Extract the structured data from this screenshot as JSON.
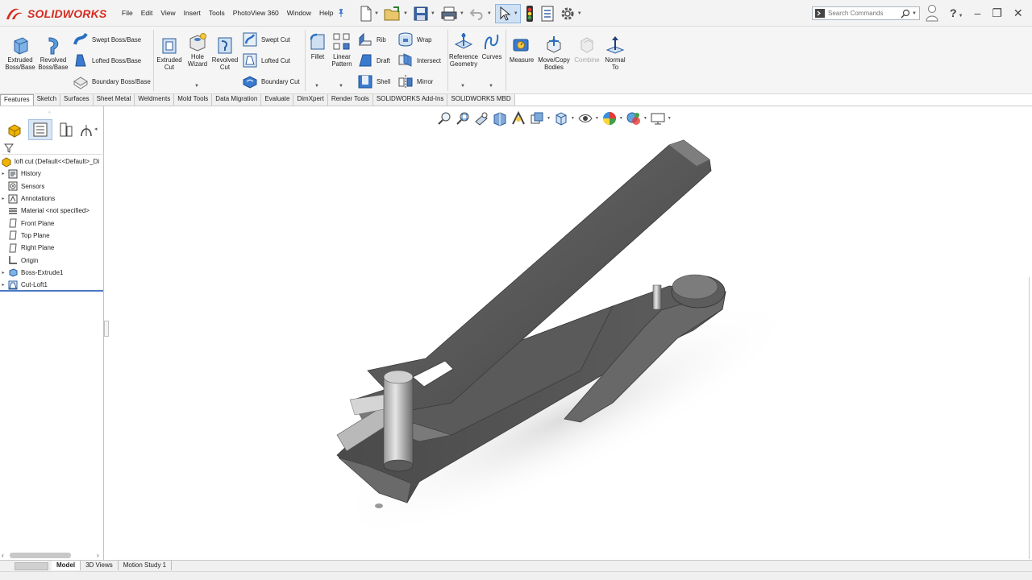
{
  "app": {
    "brand": "SOLIDWORKS",
    "menu": [
      "File",
      "Edit",
      "View",
      "Insert",
      "Tools",
      "PhotoView 360",
      "Window",
      "Help"
    ],
    "search": {
      "placeholder": "Search Commands"
    },
    "colors": {
      "brand": "#d52b1e",
      "accent": "#2a6fc2",
      "selected_tab": "#ffffff"
    }
  },
  "ribbon": {
    "extruded_boss": "Extruded\nBoss/Base",
    "revolved_boss": "Revolved\nBoss/Base",
    "swept_boss": "Swept Boss/Base",
    "lofted_boss": "Lofted Boss/Base",
    "boundary_boss": "Boundary Boss/Base",
    "extruded_cut": "Extruded\nCut",
    "hole_wizard": "Hole\nWizard",
    "revolved_cut": "Revolved\nCut",
    "swept_cut": "Swept Cut",
    "lofted_cut": "Lofted Cut",
    "boundary_cut": "Boundary Cut",
    "fillet": "Fillet",
    "linear_pattern": "Linear\nPattern",
    "rib": "Rib",
    "draft": "Draft",
    "shell": "Shell",
    "wrap": "Wrap",
    "intersect": "Intersect",
    "mirror": "Mirror",
    "reference_geometry": "Reference\nGeometry",
    "curves": "Curves",
    "measure": "Measure",
    "move_copy_bodies": "Move/Copy\nBodies",
    "combine": "Combine",
    "normal_to": "Normal\nTo"
  },
  "cm_tabs": [
    {
      "label": "Features",
      "active": true
    },
    {
      "label": "Sketch",
      "active": false
    },
    {
      "label": "Surfaces",
      "active": false
    },
    {
      "label": "Sheet Metal",
      "active": false
    },
    {
      "label": "Weldments",
      "active": false
    },
    {
      "label": "Mold Tools",
      "active": false
    },
    {
      "label": "Data Migration",
      "active": false
    },
    {
      "label": "Evaluate",
      "active": false
    },
    {
      "label": "DimXpert",
      "active": false
    },
    {
      "label": "Render Tools",
      "active": false
    },
    {
      "label": "SOLIDWORKS Add-Ins",
      "active": false
    },
    {
      "label": "SOLIDWORKS MBD",
      "active": false
    }
  ],
  "feature_tree": {
    "root": "loft cut  (Default<<Default>_Di",
    "items": [
      {
        "label": "History",
        "icon": "history-icon",
        "expandable": true
      },
      {
        "label": "Sensors",
        "icon": "sensors-icon",
        "expandable": false
      },
      {
        "label": "Annotations",
        "icon": "annotations-icon",
        "expandable": true
      },
      {
        "label": "Material <not specified>",
        "icon": "material-icon",
        "expandable": false
      },
      {
        "label": "Front Plane",
        "icon": "plane-icon",
        "expandable": false
      },
      {
        "label": "Top Plane",
        "icon": "plane-icon",
        "expandable": false
      },
      {
        "label": "Right Plane",
        "icon": "plane-icon",
        "expandable": false
      },
      {
        "label": "Origin",
        "icon": "origin-icon",
        "expandable": false
      },
      {
        "label": "Boss-Extrude1",
        "icon": "boss-extrude-icon",
        "expandable": true
      },
      {
        "label": "Cut-Loft1",
        "icon": "cut-loft-icon",
        "expandable": true
      }
    ]
  },
  "bottom_tabs": [
    {
      "label": "Model",
      "active": true
    },
    {
      "label": "3D Views",
      "active": false
    },
    {
      "label": "Motion Study 1",
      "active": false
    }
  ]
}
